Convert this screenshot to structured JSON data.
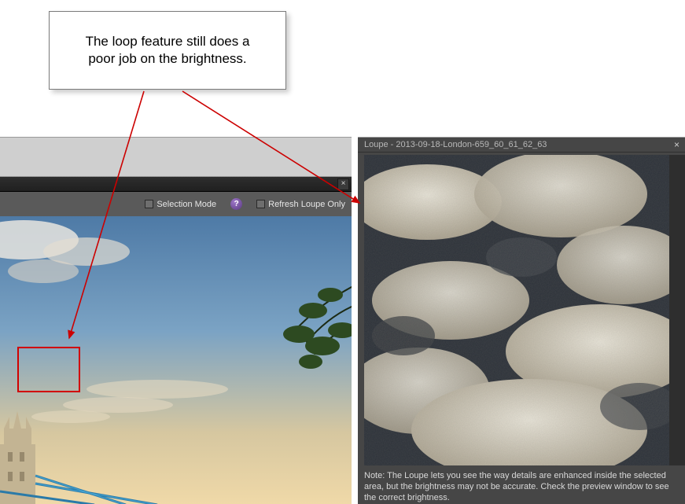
{
  "annotation": {
    "callout_text": "The loop feature still does a poor job on the brightness."
  },
  "editor": {
    "toolbar": {
      "selection_mode_label": "Selection Mode",
      "help_symbol": "?",
      "refresh_loupe_label": "Refresh Loupe Only"
    },
    "close_symbol": "×"
  },
  "loupe": {
    "title": "Loupe - 2013-09-18-London-659_60_61_62_63",
    "close_symbol": "×",
    "note": "Note: The Loupe lets you see the way details are enhanced inside the selected area, but the brightness may not be accurate. Check the preview window to see the correct brightness."
  }
}
